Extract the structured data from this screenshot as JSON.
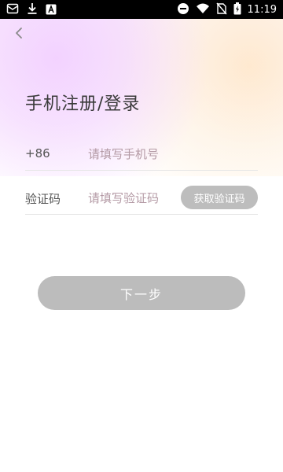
{
  "status_bar": {
    "time": "11:19",
    "left_icons": [
      "gallery-icon",
      "download-icon",
      "app-icon"
    ],
    "right_icons": [
      "do-not-disturb-icon",
      "wifi-icon",
      "no-sim-icon",
      "battery-charging-icon"
    ]
  },
  "header": {
    "back_icon": "chevron-left-icon"
  },
  "page": {
    "title": "手机注册/登录"
  },
  "phone_field": {
    "prefix": "+86",
    "value": "",
    "placeholder": "请填写手机号"
  },
  "code_field": {
    "label": "验证码",
    "value": "",
    "placeholder": "请填写验证码",
    "get_code_label": "获取验证码"
  },
  "actions": {
    "next_label": "下一步"
  },
  "colors": {
    "button_disabled": "#bcbcbc",
    "placeholder": "#b49aa5",
    "title": "#3a3a3a"
  }
}
